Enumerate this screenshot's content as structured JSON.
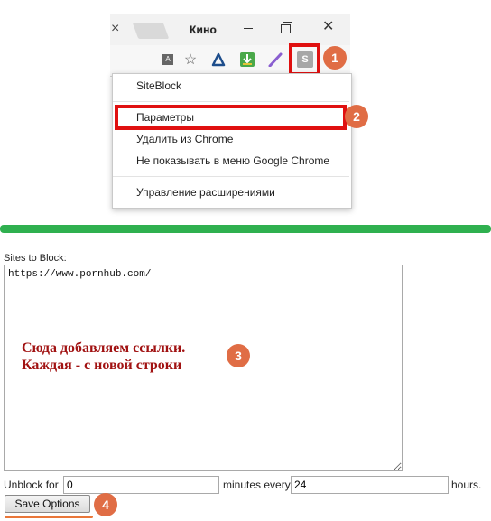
{
  "browser": {
    "tab_title": "Кино",
    "tab_close_glyph": "×",
    "window_close_glyph": "✕",
    "extension_letter": "S",
    "translate_glyph": "A",
    "star_glyph": "☆"
  },
  "menu": {
    "header": "SiteBlock",
    "items": [
      "Параметры",
      "Удалить из Chrome",
      "Не показывать в меню Google Chrome",
      "Управление расширениями"
    ]
  },
  "badges": [
    "1",
    "2",
    "3",
    "4"
  ],
  "options": {
    "sites_label": "Sites to Block:",
    "sites_value": "https://www.pornhub.com/",
    "annotation_line1": "Сюда добавляем ссылки.",
    "annotation_line2": "Каждая - с новой строки",
    "unblock_label": "Unblock for",
    "minutes_value": "0",
    "minutes_label": "minutes every",
    "hours_value": "24",
    "hours_label": "hours.",
    "save_label": "Save Options"
  },
  "colors": {
    "highlight": "#e01010",
    "badge": "#e06d45",
    "divider": "#2fb04f",
    "annotation": "#a11212"
  }
}
